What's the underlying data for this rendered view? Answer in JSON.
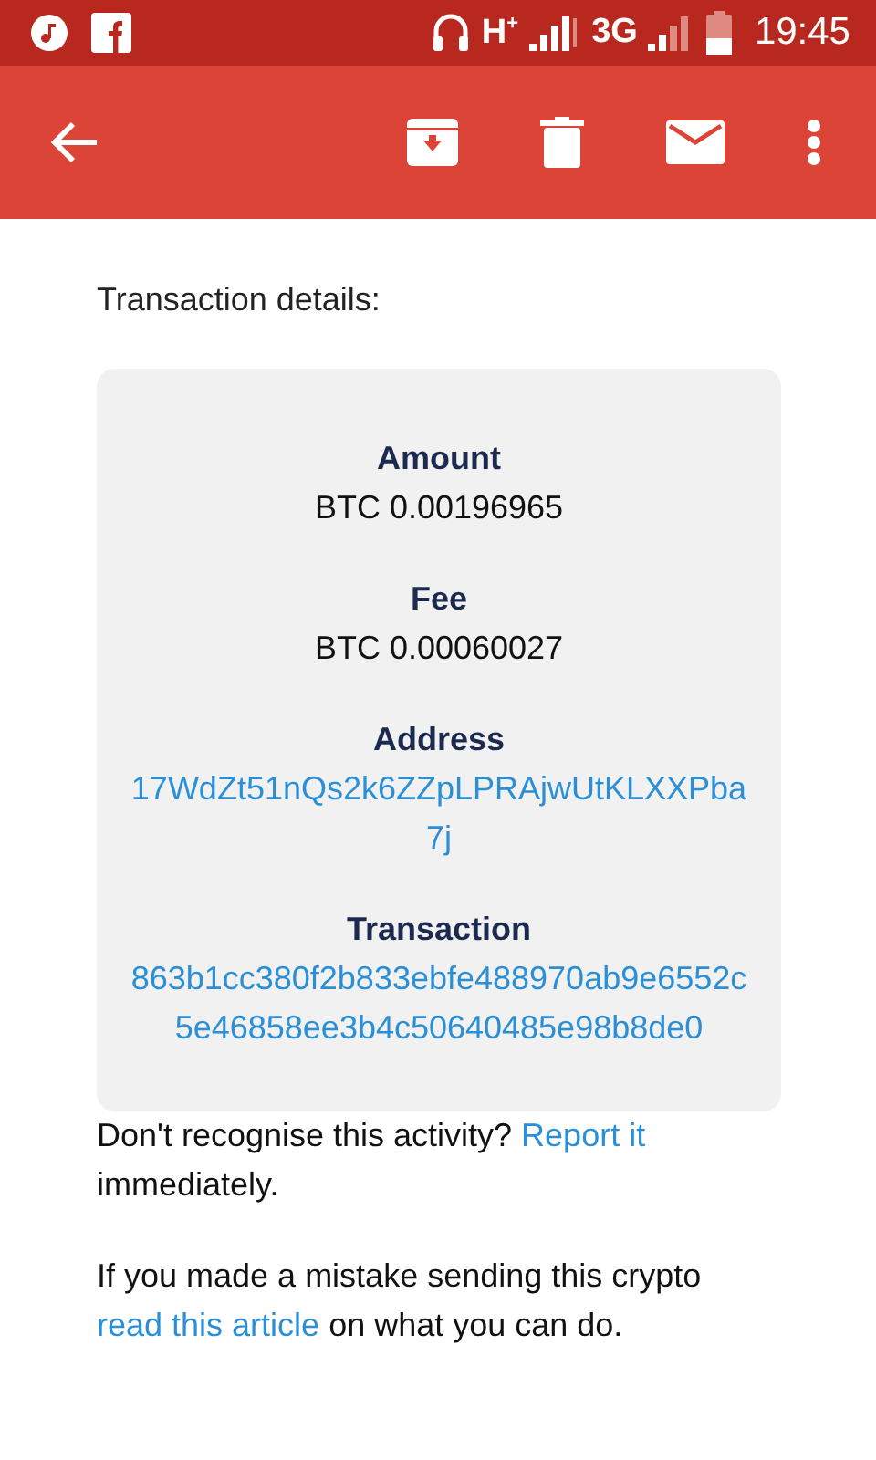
{
  "status_bar": {
    "network_1": "H",
    "network_1_sup": "+",
    "network_2": "3G",
    "time": "19:45"
  },
  "intro": "Transaction details:",
  "details": [
    {
      "label": "Amount",
      "value": "BTC 0.00196965",
      "kind": "plain"
    },
    {
      "label": "Fee",
      "value": "BTC 0.00060027",
      "kind": "plain"
    },
    {
      "label": "Address",
      "value": "17WdZt51nQs2k6ZZpLPRAjwUtKLXXPba7j",
      "kind": "link"
    },
    {
      "label": "Transaction",
      "value": "863b1cc380f2b833ebfe488970ab9e6552c5e46858ee3b4c50640485e98b8de0",
      "kind": "link"
    }
  ],
  "paragraphs": [
    [
      {
        "text": "Don't recognise this activity? ",
        "kind": "text"
      },
      {
        "text": "Report it",
        "kind": "link"
      },
      {
        "text": " immediately.",
        "kind": "text"
      }
    ],
    [
      {
        "text": "If you made a mistake sending this crypto ",
        "kind": "text"
      },
      {
        "text": "read this article",
        "kind": "link"
      },
      {
        "text": " on what you can do.",
        "kind": "text"
      }
    ]
  ]
}
